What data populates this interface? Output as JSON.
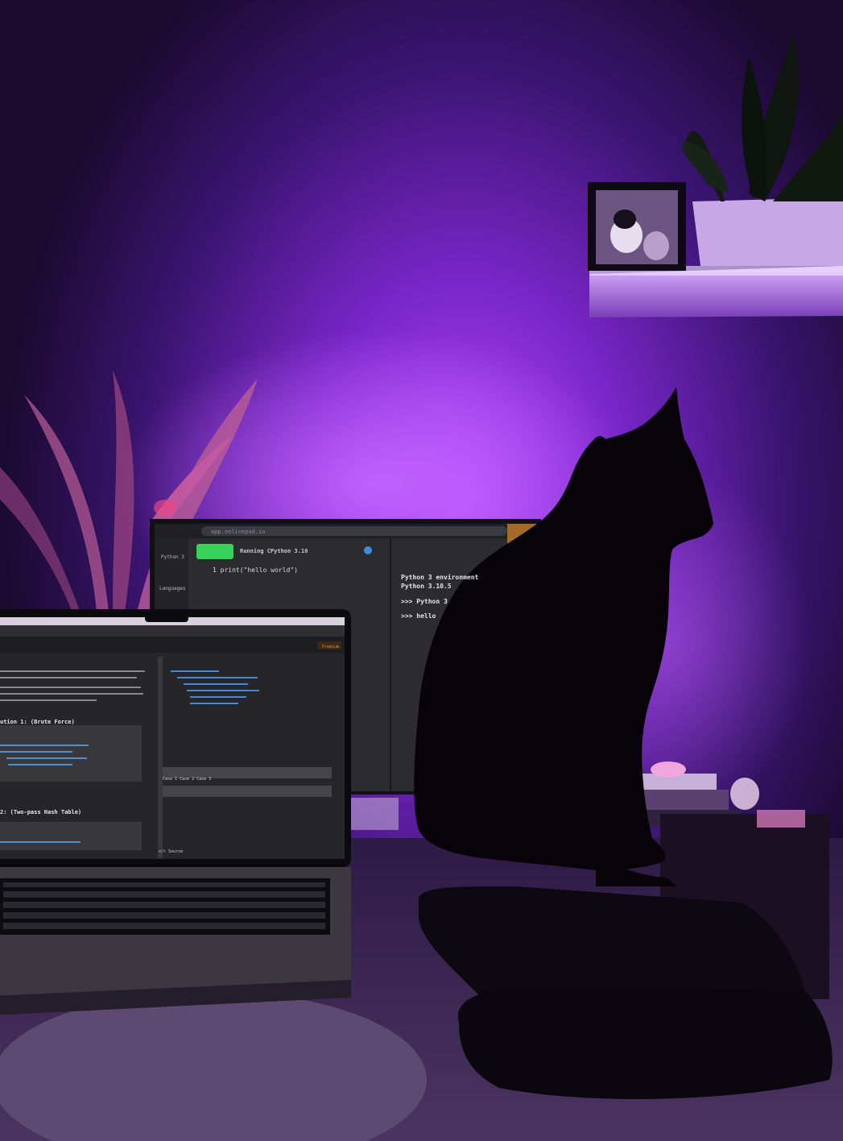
{
  "scene": {
    "description_tags": [
      "desk-setup",
      "cat-silhouette",
      "purple-backlight"
    ],
    "colors": {
      "wall_dark": "#1a0a2e",
      "glow": "#a23cf0",
      "glow_bright": "#c66bff",
      "monitor_bezel": "#121016",
      "ide_bg": "#2b2b30",
      "run_button": "#38d25b",
      "laptop_bg": "#262628",
      "silhouette": "#070309"
    }
  },
  "monitor": {
    "url_text": "app.onlinepad.io",
    "run_label": "Running CPython 3.10",
    "sidebar_label": "Python 3",
    "lang_label": "Languages",
    "code_line": "1   print(\"hello world\")",
    "output": [
      "Python 3 environment",
      "Python 3.10.5",
      ">>> Python 3",
      ">>> hello"
    ]
  },
  "laptop": {
    "heading_1": "ution 1: (Brute Force)",
    "heading_2": "2: (Two-pass Hash Table)",
    "case_label": "Case 1   Case 2   Case 3",
    "source_label": "</> Source",
    "premium_label": "Premium"
  }
}
